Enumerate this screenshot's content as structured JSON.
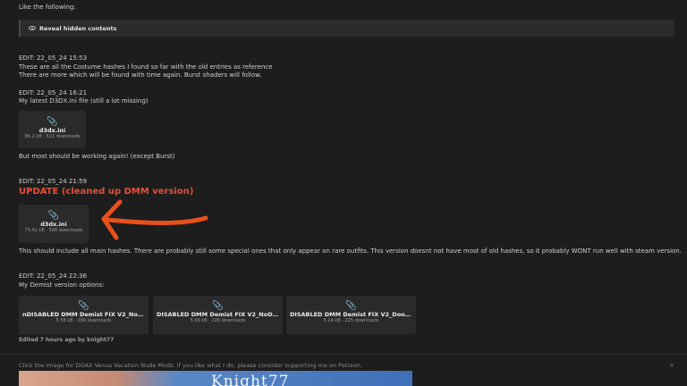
{
  "intro": "Like the following:",
  "reveal": {
    "label": "Reveal hidden contents",
    "icon": "eye-icon"
  },
  "post": {
    "edit1_time": "EDIT: 22_05_24 15:53",
    "edit1_line1": "These are all the Costume hashes I found so far with the old entries as reference",
    "edit1_line2": "There are more which will be found with time again. Burst shaders will follow.",
    "edit2_time": "EDIT: 22_05_24 16:21",
    "edit2_line1": "My latest D3DX.ini file (still a lot missing)",
    "att1": {
      "name": "d3dx.ini",
      "meta": "86.2 kB · 522 downloads"
    },
    "edit2_line2": "But most should be working again! (except Burst)",
    "edit3_time": "EDIT: 22_05_24 21:59",
    "update_heading": "UPDATE (cleaned up DMM version)",
    "att2": {
      "name": "d3dx.ini",
      "meta": "75.42 kB · 588 downloads"
    },
    "edit3_line1": "This should include all main hashes. There are probably still some special ones that only appear on rare outfits. This version doesnt not have most of old hashes, so it probably WONT run well with steam version.",
    "edit4_time": "EDIT: 22_05_24 22:36",
    "edit4_line1": "My Demist version options:",
    "demist": [
      {
        "name": "nDISABLED DMM Demist FIX V2_NoDoor...",
        "meta": "5.58 kB · 299 downloads"
      },
      {
        "name": "DISABLED DMM Demist FIX V2_NoDoors...",
        "meta": "5.56 kB · 226 downloads"
      },
      {
        "name": "DISABLED DMM Demist FIX V2_Doors_D...",
        "meta": "5.14 kB · 225 downloads"
      }
    ],
    "edited": "Edited 7 hours ago by knight77"
  },
  "ad": {
    "text": "Click the image for DOAX Venus Vacation Nude Mods. If you like what I do, please consider supporting me on Patreon.",
    "close": "×",
    "banner_text": "Knight77"
  },
  "colors": {
    "background": "#1d1d1d",
    "update_red": "#e4503a",
    "arrow": "#e8501c"
  }
}
